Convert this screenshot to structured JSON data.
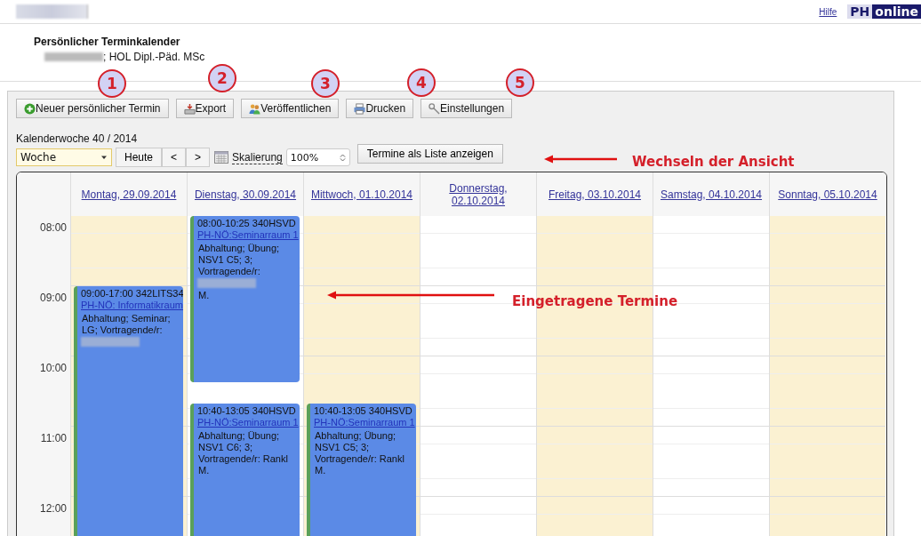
{
  "top_bar": {
    "help_link": "Hilfe",
    "logo": [
      "PH",
      "online"
    ]
  },
  "header": {
    "title": "Persönlicher Terminkalender",
    "subtitle": "; HOL Dipl.-Päd. MSc"
  },
  "toolbar": [
    {
      "label": "Neuer persönlicher Termin",
      "kind": "add"
    },
    {
      "label": "Export",
      "kind": "export"
    },
    {
      "label": "Veröffentlichen",
      "kind": "publish"
    },
    {
      "label": "Drucken",
      "kind": "print"
    },
    {
      "label": "Einstellungen",
      "kind": "settings"
    }
  ],
  "week_label": "Kalenderwoche 40 / 2014",
  "controls": {
    "view": "Woche",
    "today": "Heute",
    "prev": "<",
    "next": ">",
    "scale_label": "Skalierung",
    "scale_value": "100%",
    "list_button": "Termine als Liste anzeigen"
  },
  "calendar": {
    "hours": [
      "08:00",
      "09:00",
      "10:00",
      "11:00",
      "12:00"
    ],
    "days": [
      {
        "label": "Montag, 29.09.2014",
        "shaded": true,
        "events": [
          {
            "time": "09:00-17:00 342LITS34",
            "room": "PH-NÖ: Informatikraum",
            "desc": "Abhaltung; Seminar; LG; Vortragende/r:",
            "redacted": true
          }
        ]
      },
      {
        "label": "Dienstag, 30.09.2014",
        "shaded": false,
        "events": [
          {
            "time": "08:00-10:25 340HSVD",
            "room": "PH-NÖ:Seminarraum 1",
            "desc": "Abhaltung; Übung; NSV1 C5; 3; Vortragende/r:",
            "redacted": true,
            "desc_end": "M."
          },
          {
            "time": "10:40-13:05 340HSVD",
            "room": "PH-NÖ:Seminarraum 1",
            "desc": "Abhaltung; Übung; NSV1 C6; 3; Vortragende/r: Rankl M.",
            "redacted": false
          }
        ]
      },
      {
        "label": "Mittwoch, 01.10.2014",
        "shaded": true,
        "events": [
          {
            "time": "10:40-13:05 340HSVD",
            "room": "PH-NÖ:Seminarraum 1",
            "desc": "Abhaltung; Übung; NSV1 C5; 3; Vortragende/r: Rankl M.",
            "redacted": false
          }
        ]
      },
      {
        "label": "Donnerstag, 02.10.2014",
        "shaded": false
      },
      {
        "label": "Freitag, 03.10.2014",
        "shaded": true
      },
      {
        "label": "Samstag, 04.10.2014",
        "shaded": false
      },
      {
        "label": "Sonntag, 05.10.2014",
        "shaded": true
      }
    ]
  },
  "annotations": {
    "markers": [
      "1",
      "2",
      "3",
      "4",
      "5"
    ],
    "callouts": [
      "Wechseln der Ansicht",
      "Eingetragene Termine"
    ]
  }
}
